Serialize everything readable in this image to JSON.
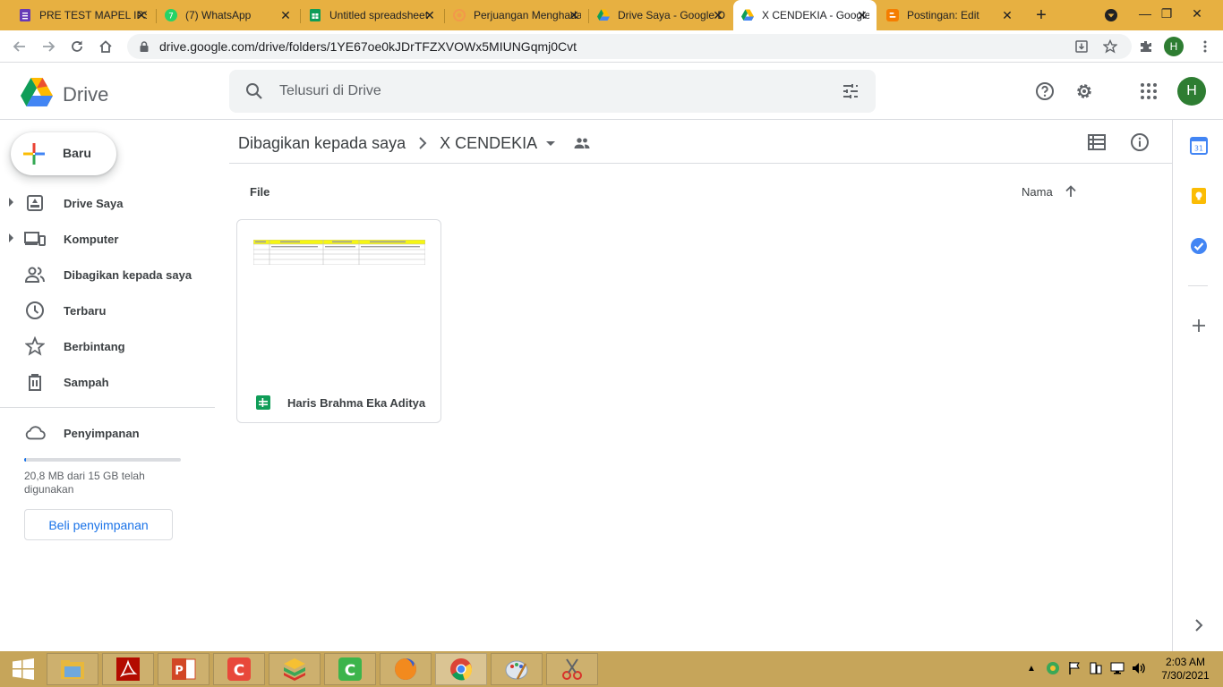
{
  "browser": {
    "tabs": [
      {
        "label": "PRE TEST MAPEL IPS",
        "icon": "forms-icon"
      },
      {
        "label": "(7) WhatsApp",
        "icon": "whatsapp-icon"
      },
      {
        "label": "Untitled spreadsheet",
        "icon": "sheets-icon"
      },
      {
        "label": "Perjuangan Menghadapi",
        "icon": "site-icon"
      },
      {
        "label": "Drive Saya - Google Drive",
        "icon": "drive-icon"
      },
      {
        "label": "X CENDEKIA - Google Drive",
        "icon": "drive-icon",
        "active": true
      },
      {
        "label": "Postingan: Edit",
        "icon": "blogger-icon"
      }
    ],
    "url": "drive.google.com/drive/folders/1YE67oe0kJDrTFZXVOWx5MIUNGqmj0Cvt",
    "profile_initial": "H"
  },
  "drive": {
    "logo_text": "Drive",
    "search_placeholder": "Telusuri di Drive",
    "avatar_initial": "H",
    "new_button": "Baru",
    "nav": [
      {
        "label": "Drive Saya",
        "icon": "my-drive-icon",
        "expandable": true
      },
      {
        "label": "Komputer",
        "icon": "computers-icon",
        "expandable": true
      },
      {
        "label": "Dibagikan kepada saya",
        "icon": "shared-icon"
      },
      {
        "label": "Terbaru",
        "icon": "clock-icon"
      },
      {
        "label": "Berbintang",
        "icon": "star-icon"
      },
      {
        "label": "Sampah",
        "icon": "trash-icon"
      }
    ],
    "storage": {
      "label": "Penyimpanan",
      "usage_text": "20,8 MB dari 15 GB telah digunakan",
      "used_fraction": 0.0014,
      "buy_button": "Beli penyimpanan"
    },
    "breadcrumb": {
      "parent": "Dibagikan kepada saya",
      "current": "X CENDEKIA"
    },
    "section_label": "File",
    "sort_label": "Nama",
    "files": [
      {
        "name": "Haris Brahma Eka Aditya",
        "type": "spreadsheet"
      }
    ]
  },
  "taskbar": {
    "time": "2:03 AM",
    "date": "7/30/2021"
  },
  "colors": {
    "tabstrip": "#e7b041",
    "taskbar": "#c6a55a",
    "accent": "#1a73e8",
    "avatar": "#2e7d32"
  }
}
